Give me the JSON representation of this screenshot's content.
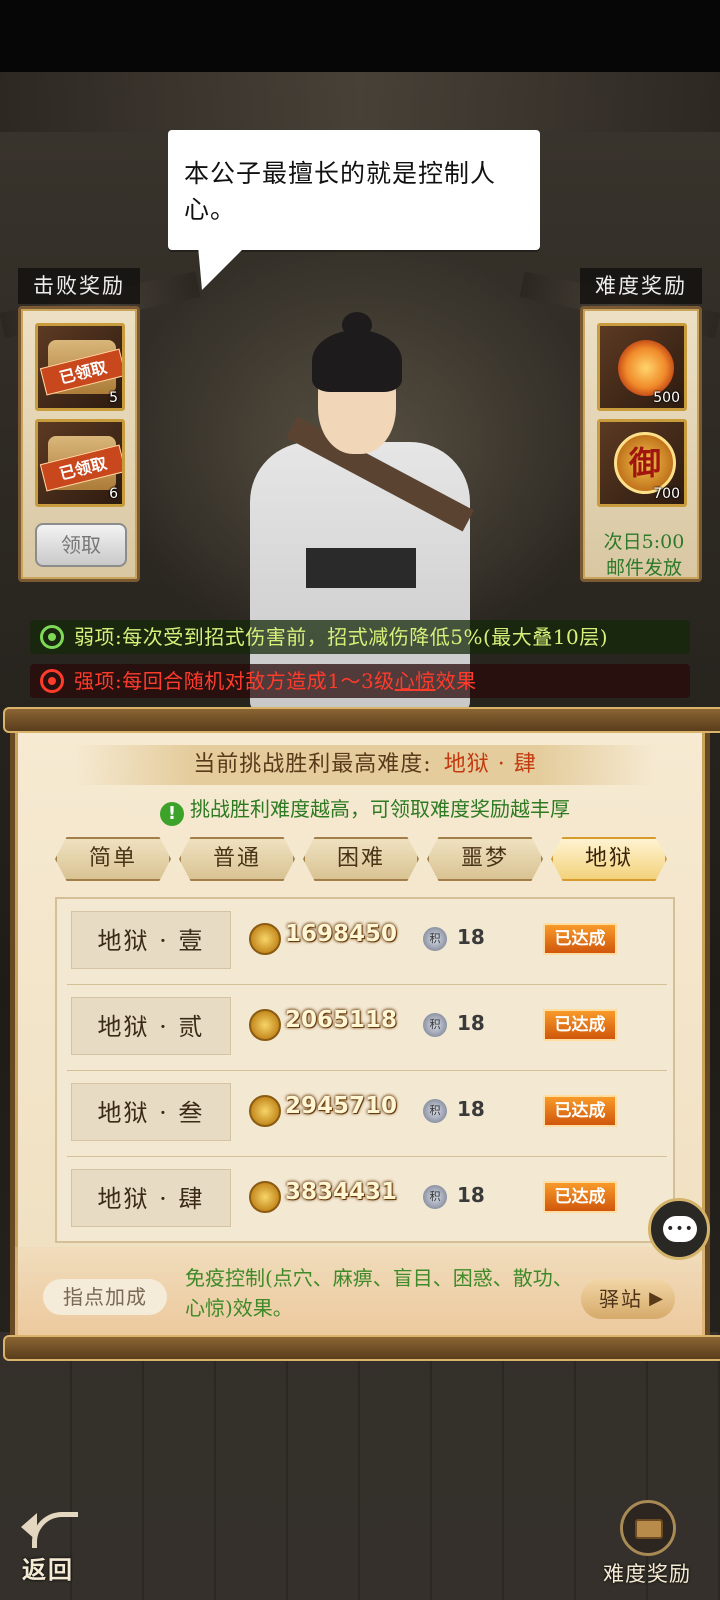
{
  "dialogue": {
    "text": "本公子最擅长的就是控制人心。"
  },
  "defeat_rewards": {
    "title": "击败奖励",
    "items": [
      {
        "status": "已领取",
        "count": "5"
      },
      {
        "status": "已领取",
        "count": "6"
      }
    ],
    "claim_label": "领取"
  },
  "difficulty_rewards": {
    "title": "难度奖励",
    "items": [
      {
        "icon": "lotus-icon",
        "count": "500"
      },
      {
        "icon": "imperial-coin-icon",
        "glyph": "御",
        "count": "700"
      }
    ],
    "mail_note_line1": "次日5:00",
    "mail_note_line2": "邮件发放"
  },
  "traits": {
    "weak": "弱项:每次受到招式伤害前，招式减伤降低5%(最大叠10层)",
    "strong_prefix": "强项:每回合随机对敌方造成1～3级",
    "strong_link": "心惊",
    "strong_suffix": "效果"
  },
  "panel": {
    "highest_label": "当前挑战胜利最高难度:",
    "highest_value": "地狱 · 肆",
    "hint": "挑战胜利难度越高，可领取难度奖励越丰厚",
    "tabs": [
      "简单",
      "普通",
      "困难",
      "噩梦",
      "地狱"
    ],
    "active_tab": "地狱",
    "rows": [
      {
        "name": "地狱 · 壹",
        "score": "1698450",
        "points": "18",
        "status": "已达成"
      },
      {
        "name": "地狱 · 贰",
        "score": "2065118",
        "points": "18",
        "status": "已达成"
      },
      {
        "name": "地狱 · 叁",
        "score": "2945710",
        "points": "18",
        "status": "已达成"
      },
      {
        "name": "地狱 · 肆",
        "score": "3834431",
        "points": "18",
        "status": "已达成"
      }
    ],
    "points_icon_glyph": "积",
    "guide_label": "指点加成",
    "guide_text": "免疫控制(点穴、麻痹、盲目、困惑、散功、心惊)效果。",
    "station_label": "驿站"
  },
  "bottom": {
    "back_label": "返回",
    "difficulty_reward_label": "难度奖励"
  },
  "colors": {
    "weak_text": "#d7f07a",
    "strong_text": "#ff3b2b",
    "hint_green": "#2e7a22",
    "achieved_orange": "#d0570c"
  }
}
